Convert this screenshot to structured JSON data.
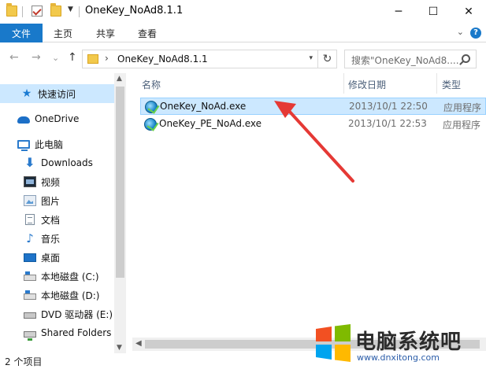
{
  "window": {
    "title": "OneKey_NoAd8.1.1",
    "minimize": "─",
    "maximize": "☐",
    "close": "✕",
    "qa_dropdown": "▼"
  },
  "ribbon": {
    "file_tab": "文件",
    "tabs": [
      "主页",
      "共享",
      "查看"
    ],
    "expand_chevron": "⌄",
    "help": "?"
  },
  "nav_buttons": {
    "back": "←",
    "forward": "→",
    "recent": "⌄",
    "up": "↑"
  },
  "address": {
    "chevron": "›",
    "path": "OneKey_NoAd8.1.1",
    "dropdown": "▾",
    "refresh": "↻"
  },
  "search": {
    "placeholder": "搜索\"OneKey_NoAd8....\""
  },
  "sidebar": {
    "items": [
      {
        "label": "快速访问",
        "icon": "quick-access-star-icon",
        "selected": true
      },
      {
        "label": "OneDrive",
        "icon": "onedrive-cloud-icon"
      },
      {
        "label": "此电脑",
        "icon": "this-pc-icon"
      },
      {
        "label": "Downloads",
        "icon": "downloads-icon"
      },
      {
        "label": "视频",
        "icon": "videos-icon"
      },
      {
        "label": "图片",
        "icon": "pictures-icon"
      },
      {
        "label": "文档",
        "icon": "documents-icon"
      },
      {
        "label": "音乐",
        "icon": "music-icon"
      },
      {
        "label": "桌面",
        "icon": "desktop-icon"
      },
      {
        "label": "本地磁盘 (C:)",
        "icon": "drive-icon"
      },
      {
        "label": "本地磁盘 (D:)",
        "icon": "drive-icon"
      },
      {
        "label": "DVD 驱动器 (E:)",
        "icon": "dvd-drive-icon"
      },
      {
        "label": "Shared Folders",
        "icon": "network-folder-icon"
      }
    ],
    "scroll_up": "▲",
    "scroll_down": "▼"
  },
  "columns": {
    "name": "名称",
    "date": "修改日期",
    "type": "类型",
    "sort_arrow": "^"
  },
  "files": [
    {
      "name": "OneKey_NoAd.exe",
      "date": "2013/10/1 22:50",
      "type": "应用程序",
      "selected": true
    },
    {
      "name": "OneKey_PE_NoAd.exe",
      "date": "2013/10/1 22:53",
      "type": "应用程序",
      "selected": false
    }
  ],
  "hscroll": {
    "left": "◀"
  },
  "status": {
    "count": "2 个项目"
  },
  "watermark": {
    "title": "电脑系统吧",
    "url": "www.dnxitong.com"
  },
  "colors": {
    "accent": "#1979ca",
    "selection": "#cce8ff",
    "arrow": "#e53935"
  }
}
